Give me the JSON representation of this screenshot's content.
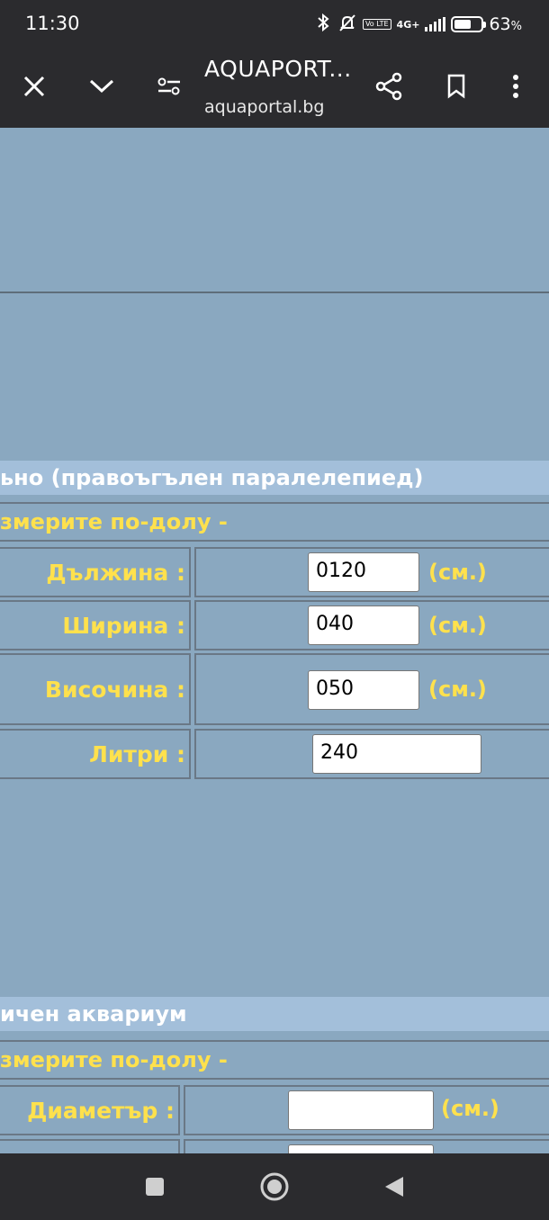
{
  "status": {
    "time": "11:30",
    "volte": "Vo LTE",
    "network": "4G+",
    "battery_percent": "63",
    "battery_unit": "%",
    "battery_level": 0.63
  },
  "browser": {
    "title": "AQUAPORT...",
    "url": "aquaportal.bg",
    "icons": {
      "close": "close-icon",
      "expand": "chevron-down-icon",
      "site_settings": "tune-icon",
      "share": "share-icon",
      "bookmark": "bookmark-icon",
      "menu": "more-vert-icon"
    }
  },
  "rect_section": {
    "title": "ьно (правоъгълен паралелепиед)",
    "instruction": "змерите по-долу -",
    "fields": [
      {
        "label": "Дължина :",
        "value": "0120",
        "unit": "(см.)"
      },
      {
        "label": "Ширина :",
        "value": "040",
        "unit": "(см.)"
      },
      {
        "label": "Височина :",
        "value": "050",
        "unit": "(см.)"
      }
    ],
    "result": {
      "label": "Литри :",
      "value": "240"
    }
  },
  "cyl_section": {
    "title": "ичен аквариум",
    "instruction": "змерите по-долу -",
    "fields": [
      {
        "label": "Диаметър :",
        "value": "",
        "unit": "(см.)"
      }
    ]
  },
  "colors": {
    "background": "#8aa8c0",
    "header_band": "#a3bfda",
    "label_yellow": "#ffe14d",
    "chrome": "#2b2b2e"
  }
}
